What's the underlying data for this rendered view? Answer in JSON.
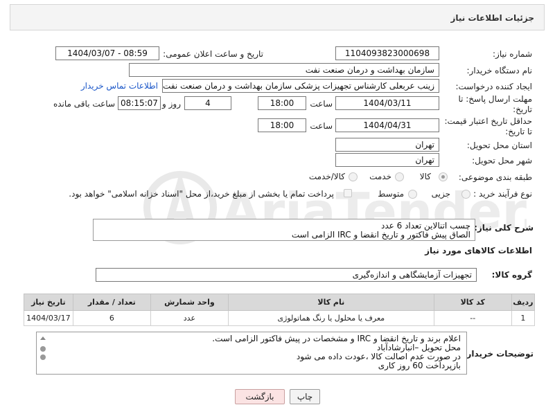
{
  "header": {
    "title": "جزئیات اطلاعات نیاز"
  },
  "fields": {
    "need_number_label": "شماره نیاز:",
    "need_number": "1104093823000698",
    "announce_label": "تاریخ و ساعت اعلان عمومی:",
    "announce_value": "1404/03/07 - 08:59",
    "buyer_org_label": "نام دستگاه خریدار:",
    "buyer_org": "سازمان بهداشت و درمان صنعت نفت",
    "creator_label": "ایجاد کننده درخواست:",
    "creator": "زینب عربعلی کارشناس تجهیزات پزشکی سازمان بهداشت و درمان صنعت نفت",
    "contact_link": "اطلاعات تماس خریدار",
    "deadline_label_1": "مهلت ارسال پاسخ: تا",
    "deadline_label_2": "تاریخ:",
    "deadline_date": "1404/03/11",
    "time_label": "ساعت",
    "deadline_time": "18:00",
    "days_value": "4",
    "days_label": "روز و",
    "remaining_time": "08:15:07",
    "remaining_label": "ساعت باقی مانده",
    "price_label_1": "حداقل تاریخ اعتبار قیمت:",
    "price_label_2": "تا تاریخ:",
    "price_date": "1404/04/31",
    "price_time": "18:00",
    "province_label": "استان محل تحویل:",
    "province": "تهران",
    "city_label": "شهر محل تحویل:",
    "city": "تهران",
    "category_label": "طبقه بندی موضوعی:",
    "category_options": [
      "کالا",
      "خدمت",
      "کالا/خدمت"
    ],
    "process_label": "نوع فرآیند خرید :",
    "process_options": [
      "جزیی",
      "متوسط"
    ],
    "payment_note": "پرداخت تمام یا بخشی از مبلغ خرید،از محل \"اسناد خزانه اسلامی\" خواهد بود.",
    "description_label": "شرح کلی نیاز:",
    "description_lines": [
      "چسب اتنالاین تعداد 6 عدد",
      "الصاق پیش فاکتور و تاریخ انقضا و IRC الزامی است"
    ],
    "goods_info_title": "اطلاعات کالاهای مورد نیاز",
    "goods_group_label": "گروه کالا:",
    "goods_group": "تجهیزات آزمایشگاهی و اندازه‌گیری"
  },
  "table": {
    "headers": [
      "ردیف",
      "کد کالا",
      "نام کالا",
      "واحد شمارش",
      "تعداد / مقدار",
      "تاریخ نیاز"
    ],
    "rows": [
      [
        "1",
        "--",
        "معرف یا محلول یا رنگ هماتولوژی",
        "عدد",
        "6",
        "1404/03/17"
      ]
    ]
  },
  "buyer_notes": {
    "label": "توضیحات خریدار:",
    "lines": [
      "اعلام برند و تاریخ انقضا و IRC و مشخصات در پیش فاکتور الزامی است.",
      "محل تحویل –انبارشادآباد",
      "در صورت عدم اصالت کالا ،عودت داده می شود",
      "بازپرداخت 60 روز کاری"
    ]
  },
  "buttons": {
    "print": "چاپ",
    "back": "بازگشت"
  },
  "watermark": {
    "text": "AriaTender.neT"
  },
  "colors": {
    "link": "#1a56c8",
    "header_bg": "#d9d9d9",
    "back_button": "#fbe3e3"
  }
}
